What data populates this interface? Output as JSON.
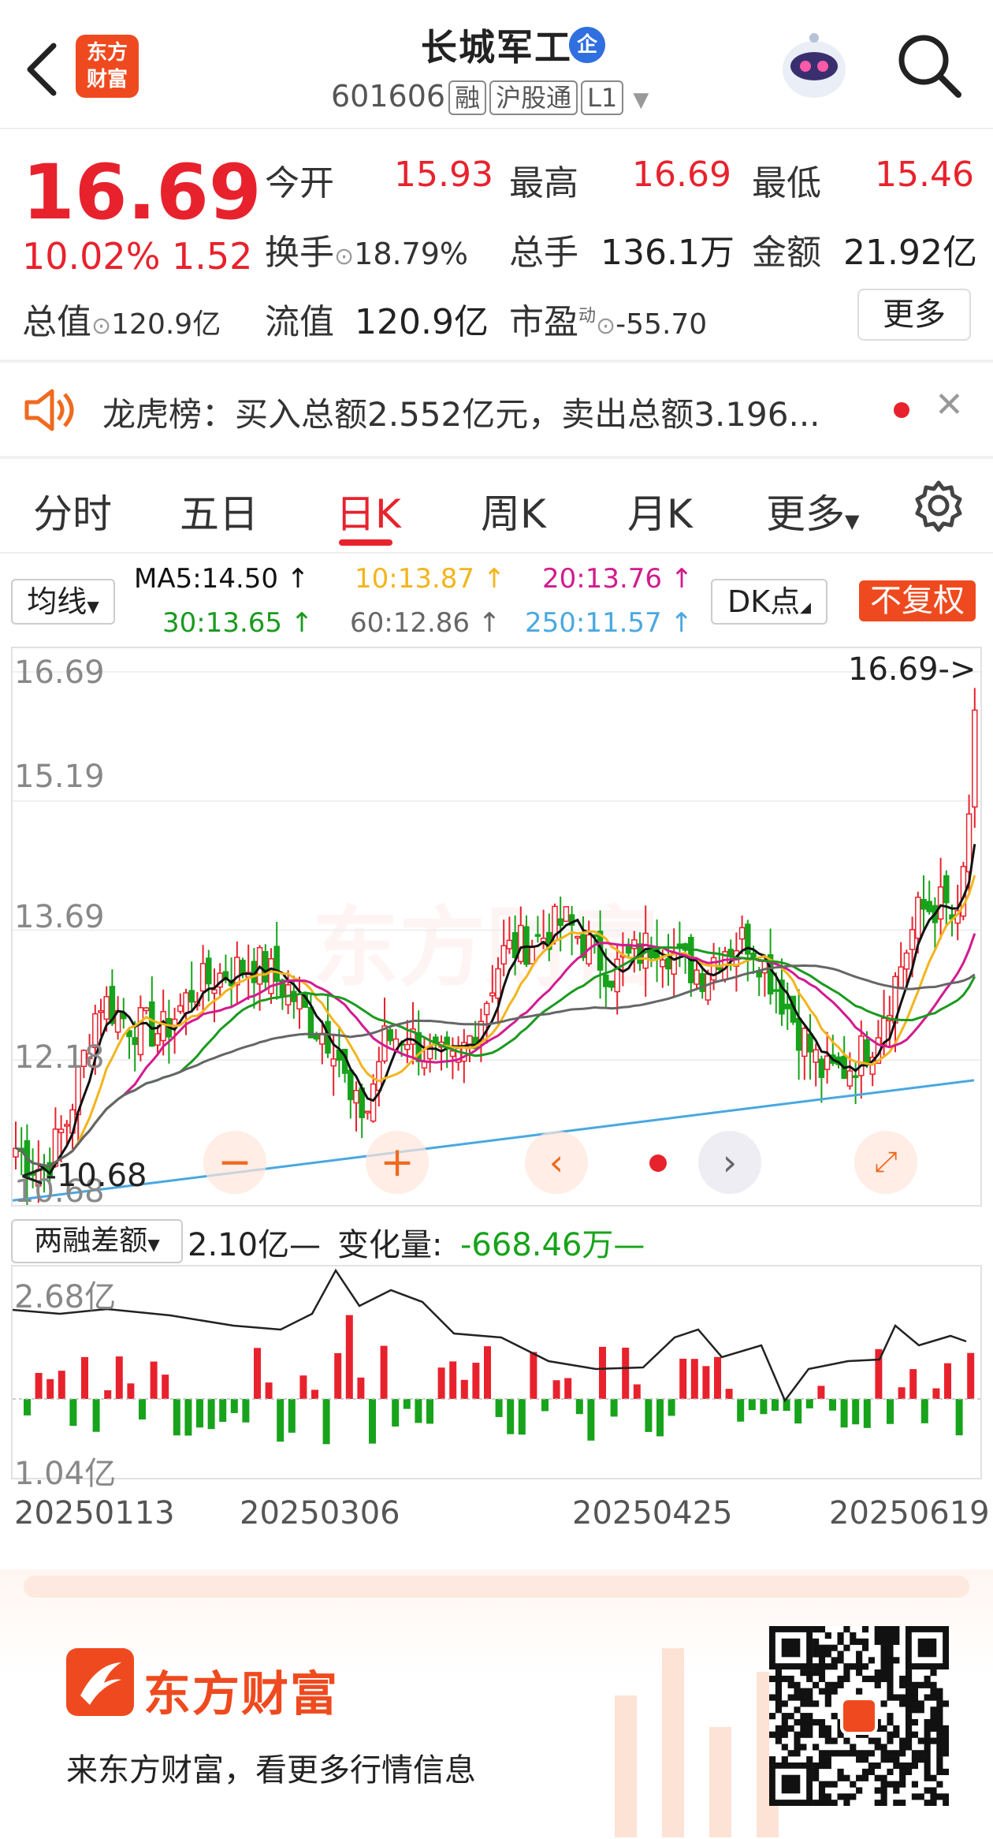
{
  "header": {
    "stock_name": "长城军工",
    "badge": "企",
    "code": "601606",
    "tags": [
      "融",
      "沪股通",
      "L1"
    ],
    "logo_text": "东方财富",
    "robot_icon": "robot-avatar-icon",
    "search_icon": "search-icon",
    "back_icon": "back-arrow-icon"
  },
  "quote": {
    "price": "16.69",
    "change_pct": "10.02%",
    "change_amt": "1.52",
    "open_label": "今开",
    "open": "15.93",
    "high_label": "最高",
    "high": "16.69",
    "low_label": "最低",
    "low": "15.46",
    "turnover_label": "换手",
    "turnover": "18.79%",
    "volume_label": "总手",
    "volume": "136.1万",
    "amount_label": "金额",
    "amount": "21.92亿",
    "mktcap_label": "总值",
    "mktcap": "120.9亿",
    "float_label": "流值",
    "float": "120.9亿",
    "pe_label": "市盈",
    "pe_sup": "动",
    "pe": "-55.70",
    "more": "更多"
  },
  "notice": {
    "text": "龙虎榜：买入总额2.552亿元，卖出总额3.196...",
    "close": "✕"
  },
  "tabs": [
    "分时",
    "五日",
    "日K",
    "周K",
    "月K",
    "更多"
  ],
  "active_tab": "日K",
  "ma_panel": {
    "selector": "均线",
    "ma5": "MA5:14.50 ↑",
    "ma10": "10:13.87 ↑",
    "ma20": "20:13.76 ↑",
    "ma30": "30:13.65 ↑",
    "ma60": "60:12.86 ↑",
    "ma250": "250:11.57 ↑",
    "dk": "DK点",
    "fq": "不复权"
  },
  "colors": {
    "up": "#e8222d",
    "down": "#17a31b",
    "ma5": "#111111",
    "ma10": "#f2b51c",
    "ma20": "#d21b8f",
    "ma30": "#1a9a1f",
    "ma60": "#666666",
    "ma250": "#4aa8e0"
  },
  "chart_data": [
    {
      "type": "candlestick",
      "y_ticks": [
        "16.69",
        "15.19",
        "13.69",
        "12.18",
        "10.68"
      ],
      "ylim": [
        10.68,
        16.69
      ],
      "last_price_label": "16.69->",
      "low_marker": "<-10.68",
      "watermark": "东方财富"
    },
    {
      "type": "bar",
      "panel_label": "两融差额",
      "value_label": "2.10亿—",
      "change_label": "变化量:",
      "change_value": "-668.46万—",
      "y_ticks": [
        "2.68亿",
        "1.04亿"
      ],
      "x_ticks": [
        "20250113",
        "20250306",
        "20250425",
        "20250619"
      ]
    }
  ],
  "footer": {
    "brand": "东方财富",
    "slogan": "来东方财富，看更多行情信息"
  }
}
